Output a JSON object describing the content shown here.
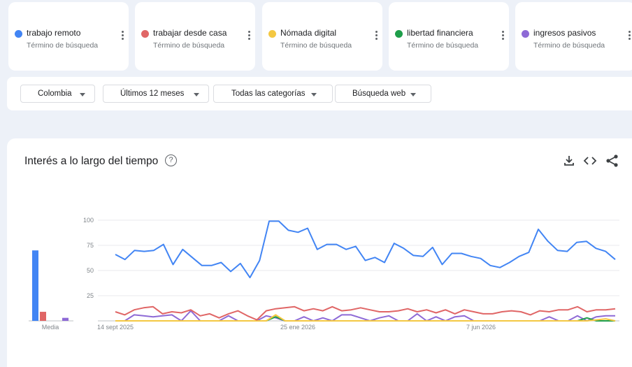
{
  "terms": [
    {
      "name": "trabajo remoto",
      "subtitle": "Término de búsqueda",
      "color": "#4285f4"
    },
    {
      "name": "trabajar desde casa",
      "subtitle": "Término de búsqueda",
      "color": "#e06666"
    },
    {
      "name": "Nómada digital",
      "subtitle": "Término de búsqueda",
      "color": "#f4c842"
    },
    {
      "name": "libertad financiera",
      "subtitle": "Término de búsqueda",
      "color": "#1e9e4a"
    },
    {
      "name": "ingresos pasivos",
      "subtitle": "Término de búsqueda",
      "color": "#8e6ad6"
    }
  ],
  "filters": [
    "Colombia",
    "Últimos 12 meses",
    "Todas las categorías",
    "Búsqueda web"
  ],
  "panel": {
    "title": "Interés a lo largo del tiempo",
    "help_icon": "help-circle-icon",
    "tools": [
      "download-icon",
      "embed-code-icon",
      "share-icon"
    ]
  },
  "chart_data": [
    {
      "type": "bar",
      "categories": [
        "Media"
      ],
      "series": [
        {
          "name": "trabajo remoto",
          "values": [
            70
          ]
        },
        {
          "name": "trabajar desde casa",
          "values": [
            9
          ]
        },
        {
          "name": "Nómada digital",
          "values": [
            0
          ]
        },
        {
          "name": "libertad financiera",
          "values": [
            0
          ]
        },
        {
          "name": "ingresos pasivos",
          "values": [
            3
          ]
        }
      ],
      "ylim": [
        0,
        100
      ]
    },
    {
      "type": "line",
      "xlabels": [
        "14 sept 2025",
        "25 ene 2026",
        "7 jun 2026"
      ],
      "yticks": [
        25,
        50,
        75,
        100
      ],
      "ylim": [
        0,
        100
      ],
      "grid": true,
      "series": [
        {
          "name": "trabajo remoto",
          "values": [
            66,
            61,
            70,
            69,
            70,
            76,
            56,
            71,
            63,
            55,
            55,
            58,
            49,
            57,
            43,
            60,
            99,
            99,
            90,
            88,
            92,
            71,
            76,
            76,
            71,
            74,
            60,
            63,
            58,
            77,
            72,
            65,
            64,
            73,
            56,
            67,
            67,
            64,
            62,
            55,
            53,
            58,
            64,
            68,
            91,
            79,
            70,
            69,
            78,
            79,
            72,
            69,
            61
          ]
        },
        {
          "name": "trabajar desde casa",
          "values": [
            9,
            6,
            11,
            13,
            14,
            7,
            9,
            8,
            11,
            5,
            7,
            3,
            7,
            10,
            5,
            1,
            10,
            12,
            13,
            14,
            10,
            12,
            10,
            14,
            10,
            11,
            13,
            11,
            9,
            9,
            10,
            12,
            9,
            11,
            8,
            11,
            7,
            11,
            9,
            7,
            7,
            9,
            10,
            9,
            6,
            10,
            9,
            11,
            11,
            14,
            9,
            11,
            11,
            12
          ]
        },
        {
          "name": "Nómada digital",
          "values": [
            0,
            0,
            0,
            0,
            0,
            0,
            0,
            0,
            0,
            0,
            0,
            0,
            0,
            0,
            0,
            0,
            0,
            6,
            0,
            0,
            0,
            0,
            0,
            0,
            0,
            0,
            0,
            0,
            0,
            0,
            0,
            0,
            0,
            0,
            0,
            0,
            0,
            0,
            0,
            0,
            0,
            0,
            0,
            0,
            0,
            0,
            0,
            0,
            0,
            0,
            0,
            1,
            2,
            0
          ]
        },
        {
          "name": "libertad financiera",
          "values": [
            0,
            0,
            0,
            0,
            0,
            0,
            0,
            0,
            0,
            0,
            0,
            0,
            0,
            0,
            0,
            0,
            0,
            4,
            0,
            0,
            0,
            0,
            0,
            0,
            0,
            0,
            0,
            0,
            0,
            0,
            0,
            0,
            0,
            0,
            0,
            0,
            0,
            0,
            0,
            0,
            0,
            0,
            0,
            0,
            0,
            0,
            0,
            0,
            0,
            0,
            3,
            0,
            0,
            0
          ]
        },
        {
          "name": "ingresos pasivos",
          "values": [
            0,
            0,
            6,
            5,
            4,
            5,
            6,
            0,
            10,
            0,
            0,
            0,
            5,
            0,
            0,
            0,
            5,
            3,
            0,
            0,
            4,
            0,
            3,
            0,
            6,
            6,
            3,
            0,
            3,
            5,
            0,
            0,
            7,
            0,
            4,
            0,
            4,
            5,
            0,
            0,
            0,
            0,
            0,
            0,
            0,
            0,
            4,
            0,
            0,
            5,
            0,
            4,
            5,
            5
          ]
        }
      ]
    }
  ]
}
